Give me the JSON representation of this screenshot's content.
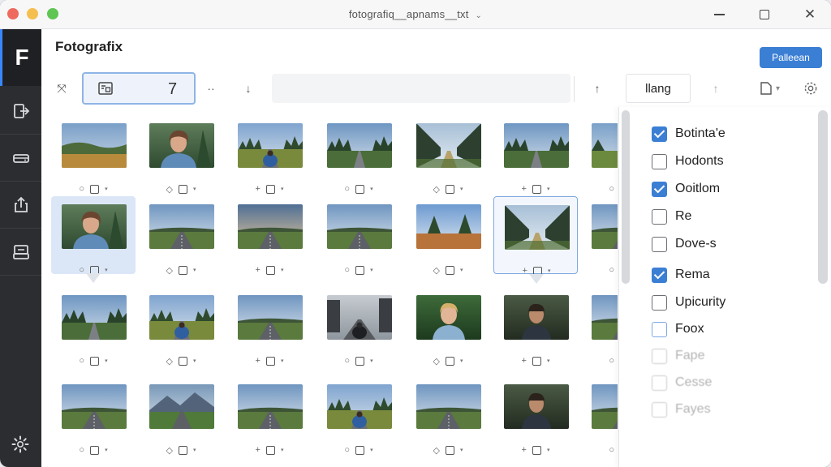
{
  "window": {
    "title": "fotografiq__apnams__txt",
    "title_chevron": "⌄",
    "min_icon": "minimize-icon",
    "max_icon": "maximize-icon",
    "close_glyph": "✕"
  },
  "sidebar": {
    "logo": "F",
    "items": [
      "import-icon",
      "drive-icon",
      "export-icon",
      "printer-icon"
    ],
    "settings_icon": "gear-icon"
  },
  "header": {
    "app_title": "Fotografix",
    "primary_button": "Palleean"
  },
  "toolbar": {
    "expand_glyph": "⤧",
    "group_text": "7",
    "more_glyph": "··",
    "down_glyph": "↓",
    "up_glyph": "↑",
    "field_value": "llang",
    "arrow_up_glyph": "↑",
    "page_glyph": "▾"
  },
  "grid": {
    "rows": [
      [
        "landscape-field",
        "portrait-woman",
        "road-walker",
        "forest-road",
        "tree-alley",
        "forest-road",
        "field-edge"
      ],
      [
        "portrait-woman",
        "road-trees",
        "road-sunset",
        "road-plain",
        "trees-autumn",
        "tree-alley",
        "road-plain"
      ],
      [
        "forest-road",
        "field-walker",
        "road-plain",
        "street-walker",
        "portrait-smile",
        "portrait-man",
        "road-plain"
      ],
      [
        "road-plain",
        "mountain-road",
        "road-plain",
        "field-walker",
        "road-plain",
        "portrait-man",
        "road-plain"
      ]
    ],
    "selected_cells": [
      [
        1,
        0
      ]
    ],
    "outlined_cells": [
      [
        1,
        5
      ]
    ]
  },
  "filters": [
    {
      "label": "Botinta'e",
      "checked": true
    },
    {
      "label": "Hodonts",
      "checked": false
    },
    {
      "label": "Ooitlom",
      "checked": true
    },
    {
      "label": "Re",
      "checked": false
    },
    {
      "label": "Dove-s",
      "checked": false
    },
    {
      "label": "Rema",
      "checked": true
    },
    {
      "label": "Upicurity",
      "checked": false
    },
    {
      "label": "Foox",
      "checked": false
    },
    {
      "label": "Fape",
      "checked": false
    },
    {
      "label": "Cesse",
      "checked": false
    },
    {
      "label": "Fayes",
      "checked": false
    }
  ],
  "colors": {
    "accent": "#3b7fd4",
    "sidebar": "#2b2d31",
    "selection": "#dbe7f7"
  }
}
